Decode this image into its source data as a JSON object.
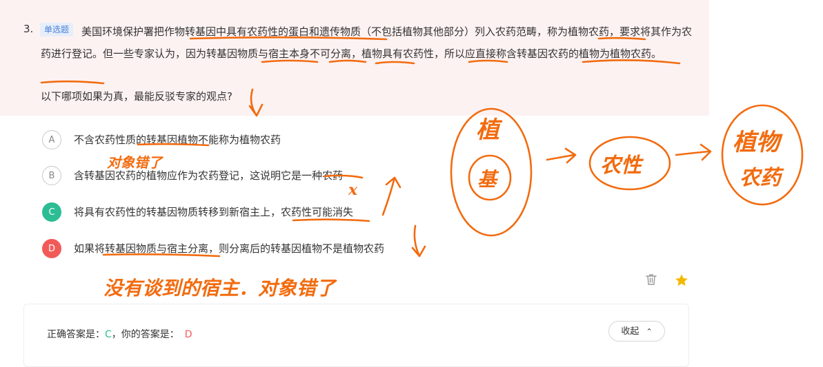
{
  "question": {
    "number": "3.",
    "type_badge": "单选题",
    "stem": "美国环境保护署把作物转基因中具有农药性的蛋白和遗传物质（不包括植物其他部分）列入农药范畴，称为植物农药，要求将其作为农药进行登记。但一些专家认为，因为转基因物质与宿主本身不可分离，植物具有农药性，所以应直接称含转基因农药的植物为植物农药。",
    "prompt": "以下哪项如果为真，最能反驳专家的观点?"
  },
  "options": [
    {
      "letter": "A",
      "text": "不含农药性质的转基因植物不能称为植物农药",
      "state": "normal"
    },
    {
      "letter": "B",
      "text": "含转基因农药的植物应作为农药登记，这说明它是一种农药",
      "state": "normal"
    },
    {
      "letter": "C",
      "text": "将具有农药性的转基因物质转移到新宿主上，农药性可能消失",
      "state": "correct"
    },
    {
      "letter": "D",
      "text": "如果将转基因物质与宿主分离，则分离后的转基因植物不是植物农药",
      "state": "wrong"
    }
  ],
  "toolbar": {
    "delete_icon": "trash-icon",
    "favorite_icon": "star-icon",
    "favorite_color": "#f5b800"
  },
  "answer": {
    "correct_label": "正确答案是：",
    "correct_value": "C",
    "separator": "，",
    "yours_label": "你的答案是：",
    "yours_value": "D",
    "collapse_label": "收起"
  },
  "handwritten_notes": {
    "note_a": "对象错了",
    "note_b": "x",
    "note_d": "没有谈到的宿主．对象错了",
    "circle_1_line1": "植",
    "circle_1_line2": "基",
    "circle_2": "农性",
    "circle_3_line1": "植物",
    "circle_3_line2": "农药",
    "ink_color": "#f26b0f"
  },
  "colors": {
    "question_bg": "#fdf2f2",
    "correct": "#2dbd95",
    "wrong": "#f25a5a",
    "badge_bg": "#e6eefb",
    "badge_text": "#4a7fd6"
  }
}
